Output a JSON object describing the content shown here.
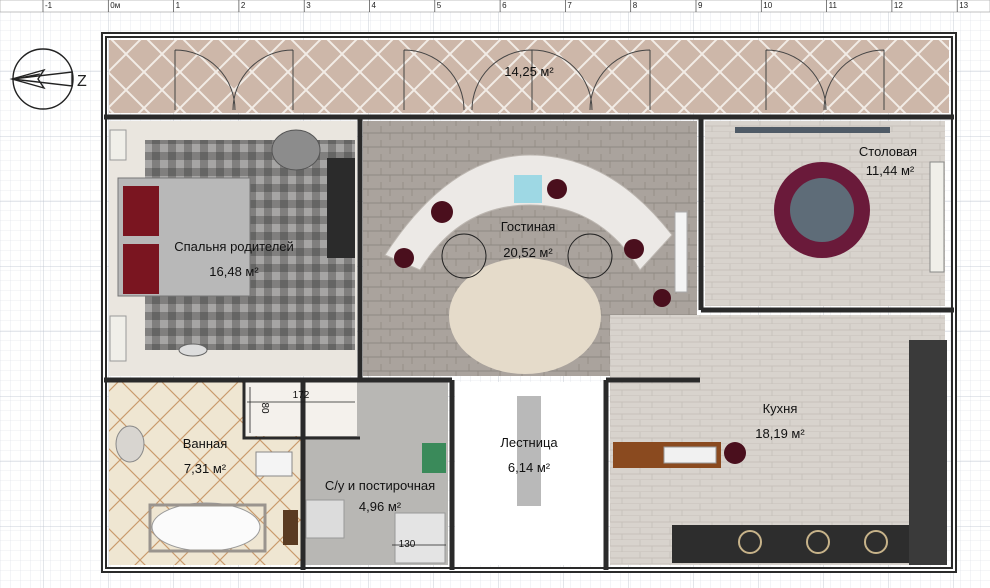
{
  "ruler": {
    "ticks": [
      "-1",
      "0м",
      "1",
      "2",
      "3",
      "4",
      "5",
      "6",
      "7",
      "8",
      "9",
      "10",
      "11",
      "12",
      "13"
    ]
  },
  "compass": {
    "north_label": "Z"
  },
  "rooms": {
    "balcony": {
      "label": "",
      "area": "14,25 м²"
    },
    "bedroom": {
      "label": "Спальня родителей",
      "area": "16,48 м²"
    },
    "living": {
      "label": "Гостиная",
      "area": "20,52 м²"
    },
    "dining": {
      "label": "Столовая",
      "area": "11,44 м²"
    },
    "kitchen": {
      "label": "Кухня",
      "area": "18,19 м²"
    },
    "bathroom": {
      "label": "Ванная",
      "area": "7,31 м²"
    },
    "wc": {
      "label": "С/у и постирочная",
      "area": "4,96 м²"
    },
    "stairs": {
      "label": "Лестница",
      "area": "6,14 м²"
    }
  },
  "dimensions": {
    "closet_width": "172",
    "closet_depth": "80",
    "wc_width": "130"
  },
  "colors": {
    "wall": "#2a2a2a",
    "balcony_tile": "#cdb7a9",
    "bedroom_floor": "#e9e5df",
    "living_floor": "#a8a29c",
    "wood_floor": "#d8d3cd",
    "bath_tile": "#efe6d2",
    "wc_tile": "#b9b8b5",
    "rug_cream": "#e6dccb",
    "accent_burgundy": "#6a1a2a",
    "grid": "#d9dde6"
  }
}
